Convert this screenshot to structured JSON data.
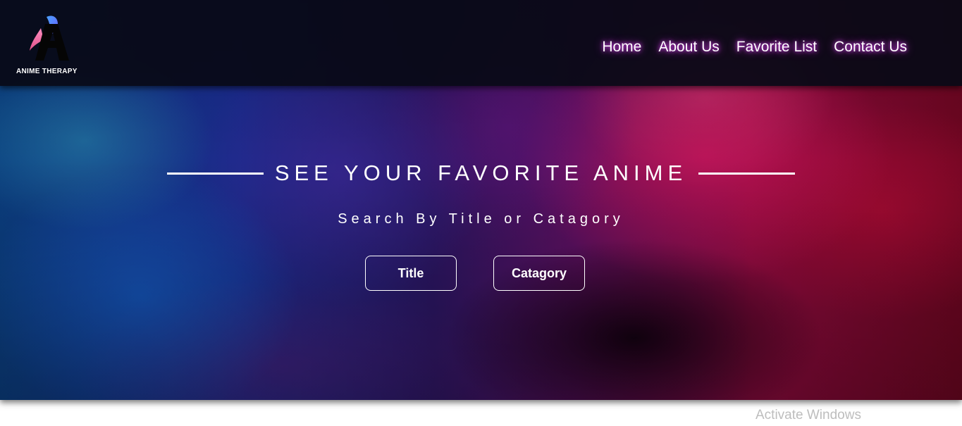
{
  "header": {
    "logo_text": "ANIME THERAPY",
    "nav": [
      {
        "label": "Home"
      },
      {
        "label": "About Us"
      },
      {
        "label": "Favorite List"
      },
      {
        "label": "Contact Us"
      }
    ]
  },
  "hero": {
    "title": "SEE YOUR FAVORITE ANIME",
    "subtitle": "Search By Title or Catagory",
    "buttons": {
      "title_label": "Title",
      "category_label": "Catagory"
    }
  },
  "watermark": "Activate Windows",
  "colors": {
    "nav_glow": "#e040fb",
    "header_bg": "#080a16",
    "logo_blue": "#3a8dff",
    "logo_pink": "#ff6fa8"
  },
  "icons": {
    "logo": "anime-therapy-logo-icon"
  }
}
